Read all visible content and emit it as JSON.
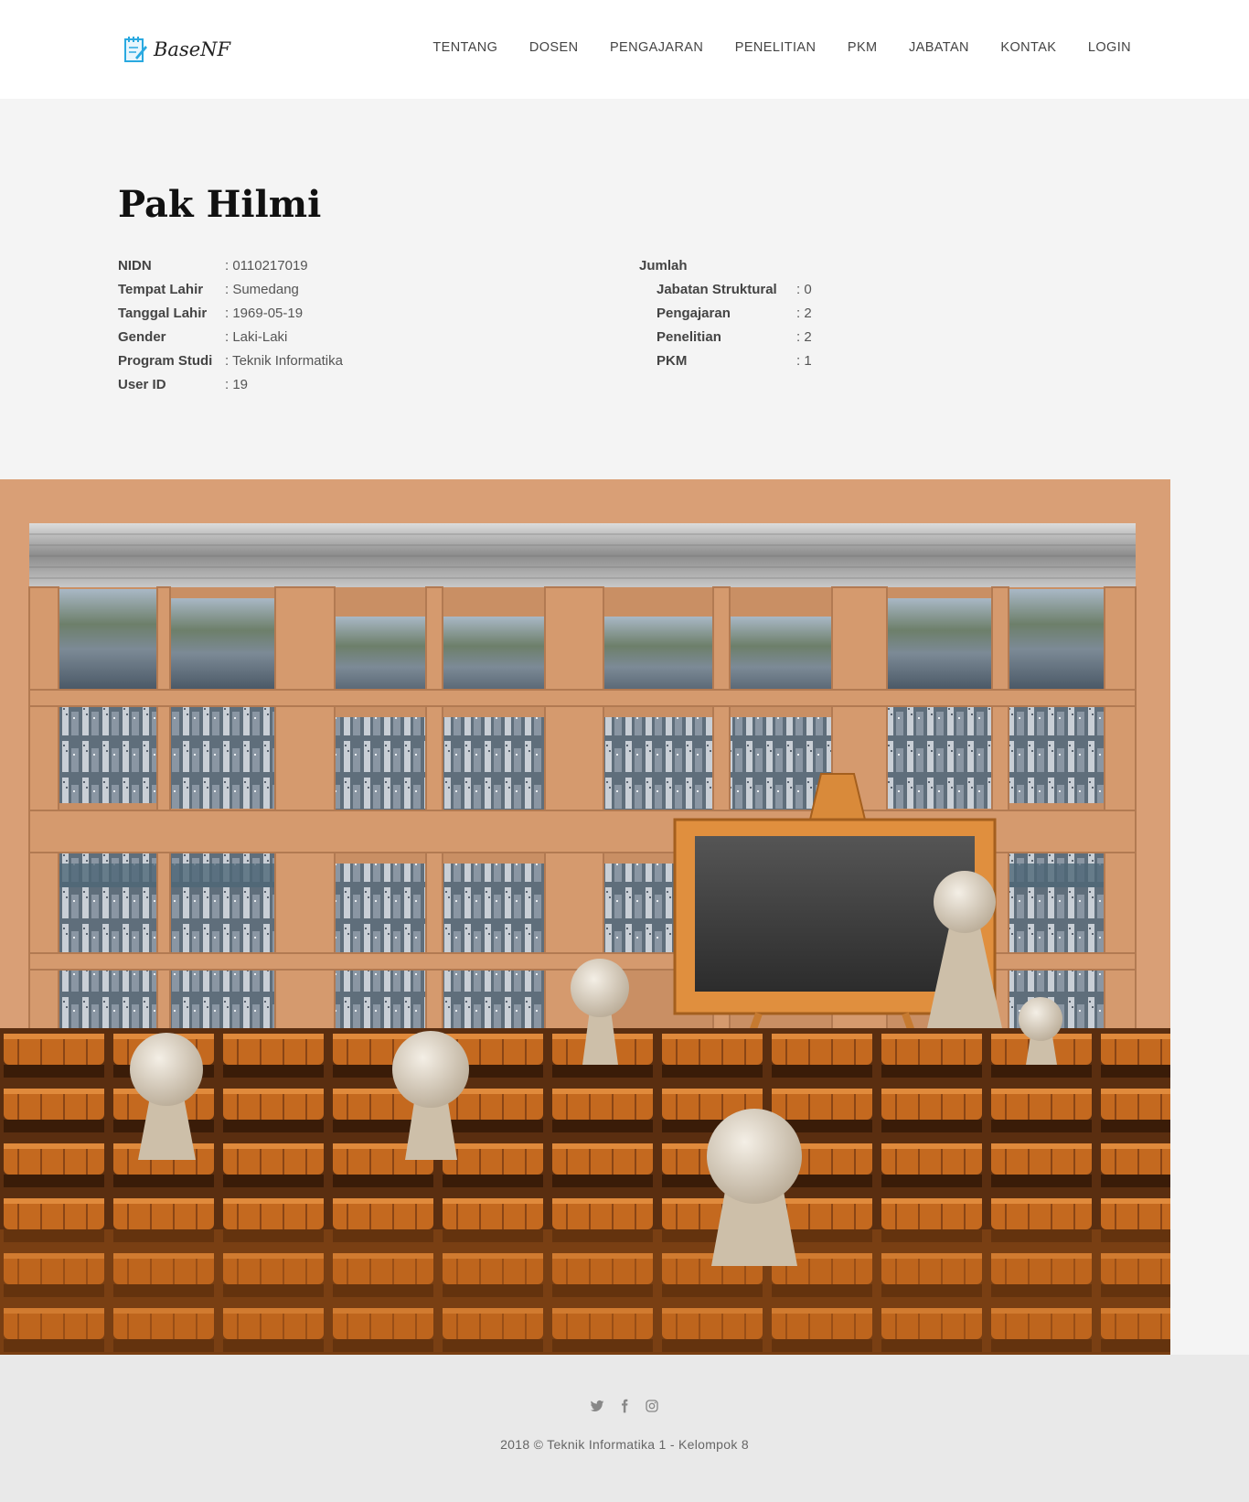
{
  "header": {
    "logo_text": "BaseNF",
    "nav": [
      {
        "label": "TENTANG"
      },
      {
        "label": "DOSEN"
      },
      {
        "label": "PENGAJARAN"
      },
      {
        "label": "PENELITIAN"
      },
      {
        "label": "PKM"
      },
      {
        "label": "JABATAN"
      },
      {
        "label": "KONTAK"
      },
      {
        "label": "LOGIN"
      }
    ]
  },
  "profile": {
    "name": "Pak Hilmi",
    "details": [
      {
        "key": "NIDN",
        "value": ": 0110217019"
      },
      {
        "key": "Tempat Lahir",
        "value": ": Sumedang"
      },
      {
        "key": "Tanggal Lahir",
        "value": ": 1969-05-19"
      },
      {
        "key": "Gender",
        "value": ": Laki-Laki"
      },
      {
        "key": "Program Studi",
        "value": ": Teknik Informatika"
      },
      {
        "key": "User ID",
        "value": ": 19"
      }
    ],
    "summary_title": "Jumlah",
    "summary": [
      {
        "key": "Jabatan Struktural",
        "value": ": 0"
      },
      {
        "key": "Pengajaran",
        "value": ": 2"
      },
      {
        "key": "Penelitian",
        "value": ": 2"
      },
      {
        "key": "PKM",
        "value": ": 1"
      }
    ]
  },
  "footer": {
    "social_icons": [
      "twitter-icon",
      "facebook-icon",
      "instagram-icon"
    ],
    "copyright": "2018 © Teknik Informatika 1 - Kelompok 8"
  },
  "colors": {
    "accent": "#2aa9e0",
    "page_bg": "#f4f4f4",
    "footer_bg": "#e9e9e9",
    "wood": "#d99f76"
  }
}
